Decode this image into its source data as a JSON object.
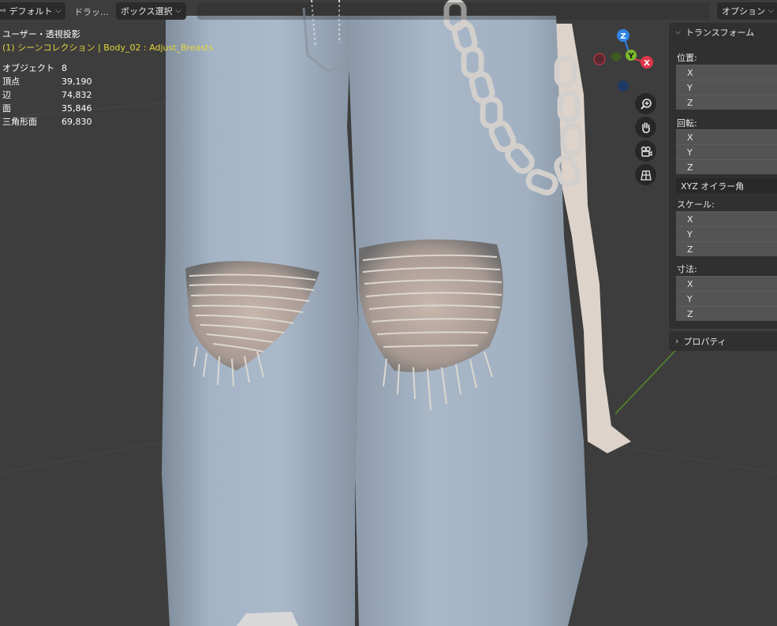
{
  "header": {
    "mode_label": "デフォルト",
    "drag_label": "ドラッ...",
    "select_label": "ボックス選択",
    "options_label": "オプション"
  },
  "overlay": {
    "view_name": "ユーザー・透視投影",
    "collection": "(1) シーンコレクション | Body_02 : Adjust_Breasts",
    "stats": [
      {
        "label": "オブジェクト",
        "value": "8"
      },
      {
        "label": "頂点",
        "value": "39,190"
      },
      {
        "label": "辺",
        "value": "74,832"
      },
      {
        "label": "面",
        "value": "35,846"
      },
      {
        "label": "三角形面",
        "value": "69,830"
      }
    ]
  },
  "gizmo": {
    "x": "X",
    "y": "Y",
    "z": "Z"
  },
  "npanel": {
    "title": "トランスフォーム",
    "location": {
      "label": "位置:",
      "x": "X",
      "y": "Y",
      "z": "Z"
    },
    "rotation": {
      "label": "回転:",
      "x": "X",
      "y": "Y",
      "z": "Z"
    },
    "rotation_mode": "XYZ オイラー角",
    "scale": {
      "label": "スケール:",
      "x": "X",
      "y": "Y",
      "z": "Z"
    },
    "dimensions": {
      "label": "寸法:",
      "x": "X",
      "y": "Y",
      "z": "Z"
    },
    "properties": "プロパティ"
  },
  "colors": {
    "background": "#3d3d3d",
    "panel": "#303030",
    "field": "#545454",
    "collection_text": "#e3d63a",
    "axis_x": "#e0364b",
    "axis_y": "#7ab82d",
    "axis_z": "#2f84e3"
  },
  "icons": [
    "zoom-icon",
    "hand-icon",
    "camera-icon",
    "grid-icon",
    "chevron-down-icon",
    "chevron-right-icon"
  ]
}
